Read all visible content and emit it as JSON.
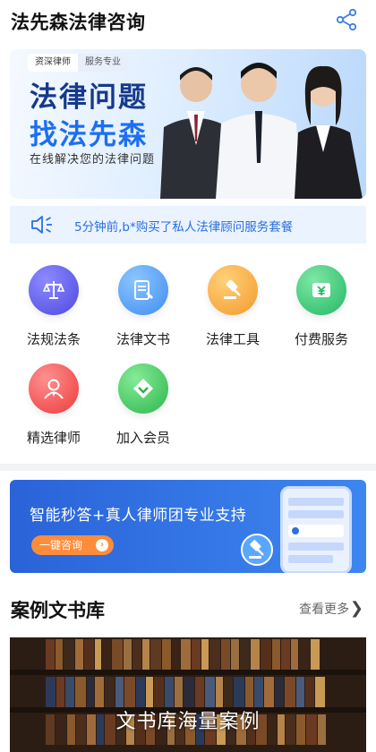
{
  "header": {
    "title": "法先森法律咨询"
  },
  "hero": {
    "tag_1": "资深律师",
    "tag_2": "服务专业",
    "headline_1": "法律问题",
    "headline_2": "找法先森",
    "subtitle": "在线解决您的法律问题"
  },
  "notice": {
    "text": "5分钟前,b*购买了私人法律顾问服务套餐"
  },
  "services": [
    {
      "label": "法规法条",
      "color": "#5a59e8",
      "icon": "scales-icon"
    },
    {
      "label": "法律文书",
      "color": "#4f9cf3",
      "icon": "document-icon"
    },
    {
      "label": "法律工具",
      "color": "#f5a53a",
      "icon": "gavel-icon"
    },
    {
      "label": "付费服务",
      "color": "#35c879",
      "icon": "yuan-icon"
    },
    {
      "label": "精选律师",
      "color": "#f15050",
      "icon": "lawyer-icon"
    },
    {
      "label": "加入会员",
      "color": "#3cc25e",
      "icon": "vip-icon"
    }
  ],
  "promo": {
    "title": "智能秒答+真人律师团专业支持",
    "button": "一键咨询"
  },
  "section": {
    "title": "案例文书库",
    "more": "查看更多"
  },
  "library": {
    "caption": "文书库海量案例"
  },
  "colors": {
    "accent": "#2b6fe0",
    "orange": "#ff8c3a"
  }
}
